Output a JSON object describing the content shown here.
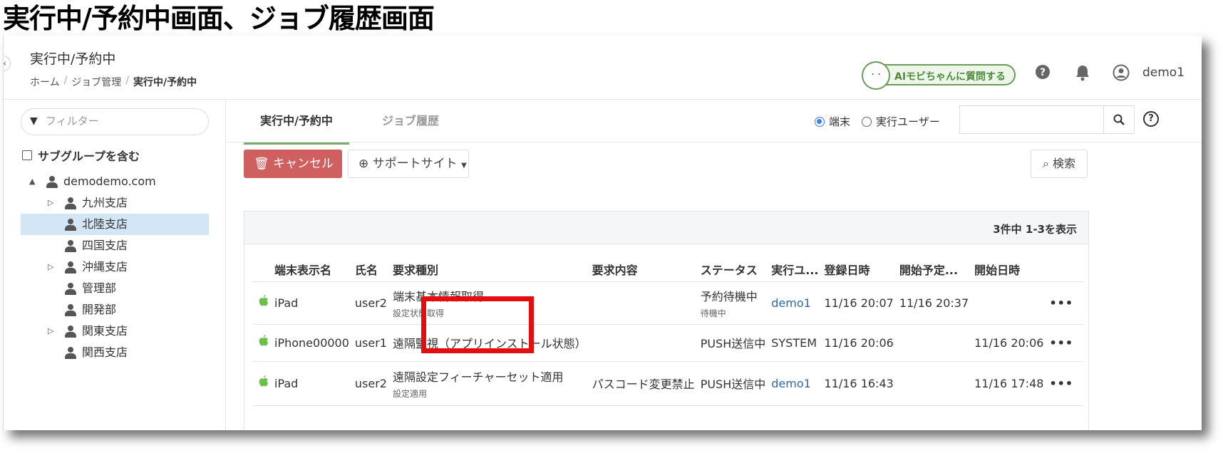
{
  "doc_title": "実行中/予約中画面、ジョブ履歴画面",
  "header": {
    "title": "実行中/予約中",
    "breadcrumb": [
      "ホーム",
      "ジョブ管理",
      "実行中/予約中"
    ],
    "ai_button_label": "AIモビちゃんに質問する",
    "username": "demo1"
  },
  "sidebar": {
    "filter_placeholder": "フィルター",
    "include_subgroup": "サブグループを含む",
    "tree": [
      {
        "label": "demodemo.com",
        "level": 0,
        "toggle": "▲"
      },
      {
        "label": "九州支店",
        "level": 1,
        "toggle": "▷"
      },
      {
        "label": "北陸支店",
        "level": 1,
        "toggle": "",
        "selected": true
      },
      {
        "label": "四国支店",
        "level": 1,
        "toggle": ""
      },
      {
        "label": "沖縄支店",
        "level": 1,
        "toggle": "▷"
      },
      {
        "label": "管理部",
        "level": 1,
        "toggle": ""
      },
      {
        "label": "開発部",
        "level": 1,
        "toggle": ""
      },
      {
        "label": "関東支店",
        "level": 1,
        "toggle": "▷"
      },
      {
        "label": "関西支店",
        "level": 1,
        "toggle": ""
      }
    ]
  },
  "tabs": {
    "active": "実行中/予約中",
    "history": "ジョブ履歴"
  },
  "scope": {
    "device": "端末",
    "user": "実行ユーザー",
    "selected": "device"
  },
  "toolbar": {
    "cancel": "キャンセル",
    "support": "サポートサイト",
    "search": "検索"
  },
  "count_text": "3件中 1-3を表示",
  "table": {
    "headers": [
      "",
      "端末表示名",
      "氏名",
      "要求種別",
      "要求内容",
      "ステータス",
      "実行ユ...",
      "登録日時",
      "開始予定...",
      "開始日時",
      ""
    ],
    "rows": [
      {
        "device": "iPad",
        "name": "user2",
        "type": "端末基本情報取得",
        "type_sub": "設定状態取得",
        "content": "",
        "status": "予約待機中",
        "status_sub": "待機中",
        "user": "demo1",
        "registered": "11/16 20:07",
        "scheduled": "11/16 20:37",
        "started": ""
      },
      {
        "device": "iPhone00000",
        "name": "user1",
        "type": "遠隔監視（アプリインストール状態）",
        "type_sub": "",
        "content": "",
        "status": "PUSH送信中",
        "status_sub": "",
        "user": "SYSTEM",
        "registered": "11/16 20:06",
        "scheduled": "",
        "started": "11/16 20:06"
      },
      {
        "device": "iPad",
        "name": "user2",
        "type": "遠隔設定フィーチャーセット適用",
        "type_sub": "設定適用",
        "content": "パスコード変更禁止",
        "status": "PUSH送信中",
        "status_sub": "",
        "user": "demo1",
        "registered": "11/16 16:43",
        "scheduled": "",
        "started": "11/16 17:48"
      }
    ]
  },
  "colors": {
    "accent_green": "#7aab6a",
    "cancel_red": "#d0605f",
    "link_blue": "#2f6aa7",
    "highlight_red": "#e30f0f",
    "selected_row": "#d3e6f6"
  }
}
